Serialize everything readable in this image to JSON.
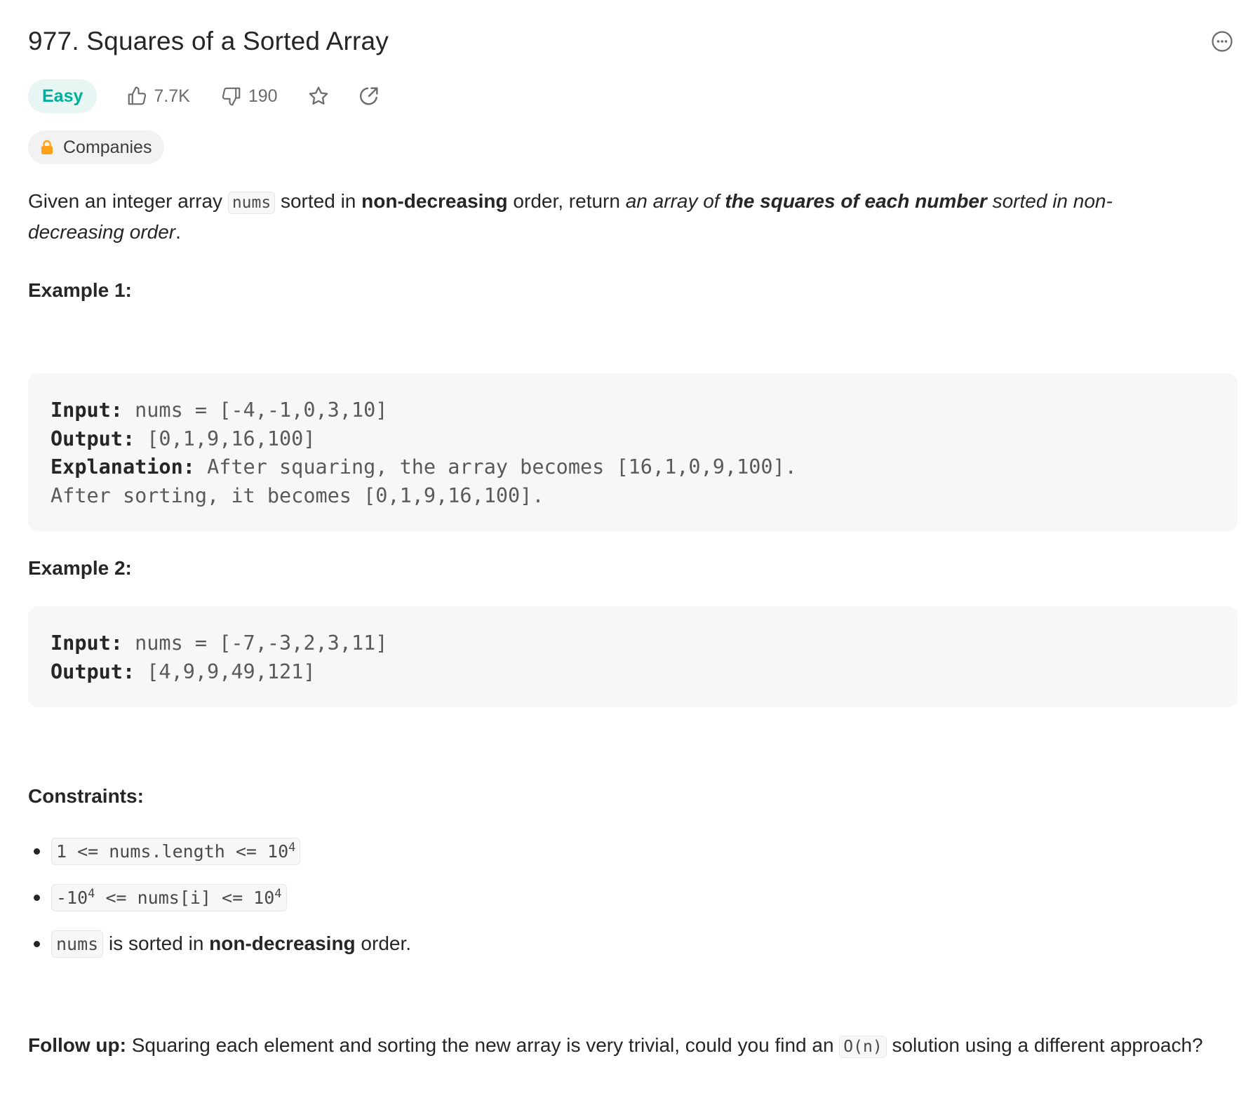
{
  "problem": {
    "title": "977. Squares of a Sorted Array",
    "difficulty": "Easy",
    "likes": "7.7K",
    "dislikes": "190",
    "companies_label": "Companies"
  },
  "description": {
    "p1": "Given an integer array ",
    "code_nums": "nums",
    "p2": " sorted in ",
    "b1": "non-decreasing",
    "p3": " order, return ",
    "i1": "an array of ",
    "bi1": "the squares of each number",
    "i2": " sorted in non-decreasing order",
    "p4": "."
  },
  "example1": {
    "heading": "Example 1:",
    "input_label": "Input:",
    "input_value": " nums = [-4,-1,0,3,10]",
    "output_label": "Output:",
    "output_value": " [0,1,9,16,100]",
    "explanation_label": "Explanation:",
    "explanation_value": " After squaring, the array becomes [16,1,0,9,100].",
    "explanation_line2": "After sorting, it becomes [0,1,9,16,100]."
  },
  "example2": {
    "heading": "Example 2:",
    "input_label": "Input:",
    "input_value": " nums = [-7,-3,2,3,11]",
    "output_label": "Output:",
    "output_value": " [4,9,9,49,121]"
  },
  "constraints": {
    "heading": "Constraints:",
    "c1_a": "1 <= nums.length <= 10",
    "c1_sup": "4",
    "c2_a": "-10",
    "c2_sup1": "4",
    "c2_b": " <= nums[i] <= 10",
    "c2_sup2": "4",
    "c3_code": "nums",
    "c3_a": " is sorted in ",
    "c3_b": "non-decreasing",
    "c3_c": " order."
  },
  "follow_up": {
    "label": "Follow up:",
    "text1": " Squaring each element and sorting the new array is very trivial, could you find an ",
    "code": "O(n)",
    "text2": " solution using a different approach?"
  },
  "icons": [
    "thumbs-up-icon",
    "thumbs-down-icon",
    "star-icon",
    "share-icon",
    "lock-icon",
    "more-icon"
  ],
  "colors": {
    "easy_text": "#00af9b",
    "easy_bg": "#e7f6f3",
    "lock": "#ffa116"
  }
}
